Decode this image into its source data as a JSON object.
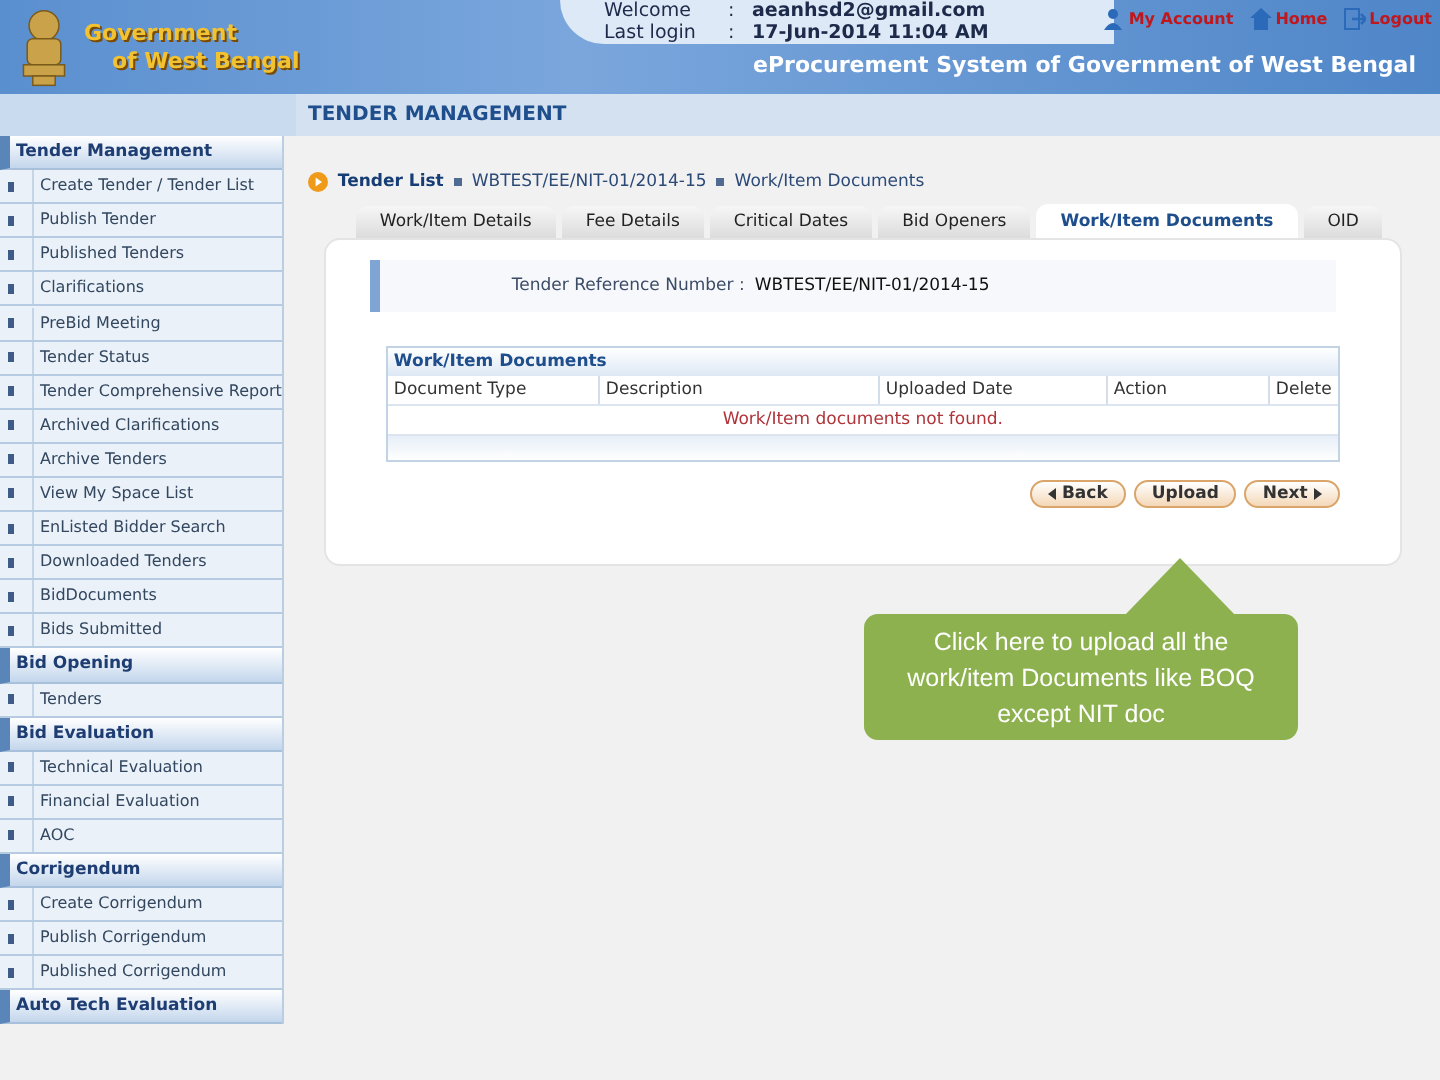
{
  "header": {
    "logo_lines": [
      "Government",
      "of West Bengal"
    ],
    "welcome": {
      "label": "Welcome",
      "separator": ":",
      "value": "aeanhsd2@gmail.com"
    },
    "last_login": {
      "label": "Last login",
      "separator": ":",
      "value": "17-Jun-2014 11:04 AM"
    },
    "links": [
      {
        "kind": "account",
        "label": "My Account"
      },
      {
        "kind": "home",
        "label": "Home"
      },
      {
        "kind": "logout",
        "label": "Logout"
      }
    ],
    "system_title": "eProcurement System of Government of West Bengal"
  },
  "page_title": "TENDER MANAGEMENT",
  "sidebar": [
    {
      "kind": "heading",
      "label": "Tender Management"
    },
    {
      "kind": "item",
      "label": "Create Tender / Tender List"
    },
    {
      "kind": "item",
      "label": "Publish Tender"
    },
    {
      "kind": "item",
      "label": "Published Tenders"
    },
    {
      "kind": "item",
      "label": "Clarifications"
    },
    {
      "kind": "item",
      "label": "PreBid Meeting"
    },
    {
      "kind": "item",
      "label": "Tender Status"
    },
    {
      "kind": "item",
      "label": "Tender Comprehensive Report"
    },
    {
      "kind": "item",
      "label": "Archived Clarifications"
    },
    {
      "kind": "item",
      "label": "Archive Tenders"
    },
    {
      "kind": "item",
      "label": "View My Space List"
    },
    {
      "kind": "item",
      "label": "EnListed Bidder Search"
    },
    {
      "kind": "item",
      "label": "Downloaded Tenders"
    },
    {
      "kind": "item",
      "label": "BidDocuments"
    },
    {
      "kind": "item",
      "label": "Bids Submitted"
    },
    {
      "kind": "heading",
      "label": "Bid Opening"
    },
    {
      "kind": "item",
      "label": "Tenders"
    },
    {
      "kind": "heading",
      "label": "Bid Evaluation"
    },
    {
      "kind": "item",
      "label": "Technical Evaluation"
    },
    {
      "kind": "item",
      "label": "Financial Evaluation"
    },
    {
      "kind": "item",
      "label": "AOC"
    },
    {
      "kind": "heading",
      "label": "Corrigendum"
    },
    {
      "kind": "item",
      "label": "Create Corrigendum"
    },
    {
      "kind": "item",
      "label": "Publish Corrigendum"
    },
    {
      "kind": "item",
      "label": "Published Corrigendum"
    },
    {
      "kind": "heading",
      "label": "Auto Tech Evaluation"
    }
  ],
  "breadcrumb": [
    "Tender List",
    "WBTEST/EE/NIT-01/2014-15",
    "Work/Item Documents"
  ],
  "tabs": [
    {
      "label": "Work/Item Details",
      "selected": false
    },
    {
      "label": "Fee Details",
      "selected": false
    },
    {
      "label": "Critical Dates",
      "selected": false
    },
    {
      "label": "Bid Openers",
      "selected": false
    },
    {
      "label": "Work/Item Documents",
      "selected": true
    },
    {
      "label": "OID",
      "selected": false
    }
  ],
  "reference": {
    "label": "Tender Reference Number :",
    "value": "WBTEST/EE/NIT-01/2014-15"
  },
  "table": {
    "title": "Work/Item Documents",
    "columns": [
      "Document Type",
      "Description",
      "Uploaded Date",
      "Action",
      "Delete"
    ],
    "empty_message": "Work/Item documents not found."
  },
  "buttons": [
    {
      "kind": "back",
      "label": "Back"
    },
    {
      "kind": "upload",
      "label": "Upload"
    },
    {
      "kind": "next",
      "label": "Next"
    }
  ],
  "callout": "Click here to upload all the work/item Documents like BOQ except NIT doc"
}
